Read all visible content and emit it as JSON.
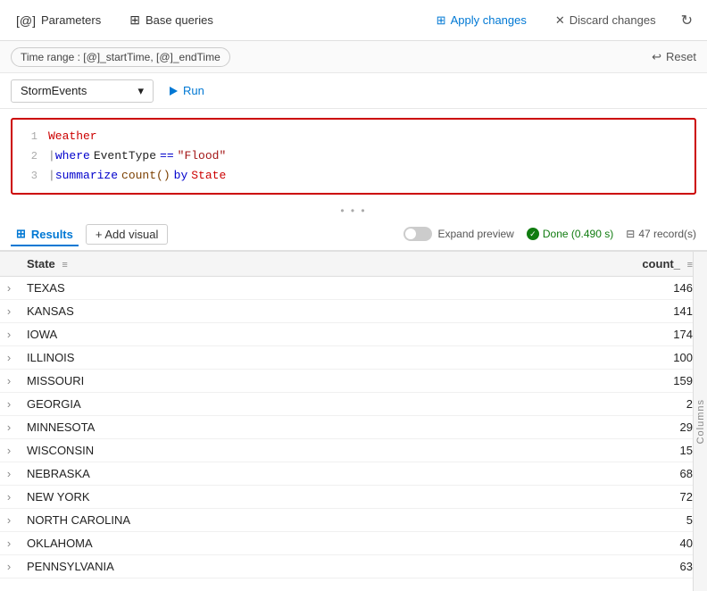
{
  "toolbar": {
    "parameters_label": "Parameters",
    "base_queries_label": "Base queries",
    "apply_label": "Apply changes",
    "discard_label": "Discard changes"
  },
  "time_range": {
    "label": "Time range : [@]_startTime, [@]_endTime",
    "reset_label": "Reset"
  },
  "query_bar": {
    "dataset": "StormEvents",
    "run_label": "Run"
  },
  "code": {
    "line1": "Weather",
    "line2_pipe": "|",
    "line2_kw": "where",
    "line2_field": "EventType",
    "line2_op": "==",
    "line2_val": "\"Flood\"",
    "line3_pipe": "|",
    "line3_kw": "summarize",
    "line3_fn": "count()",
    "line3_by": "by",
    "line3_field": "State"
  },
  "results": {
    "tab_label": "Results",
    "add_visual_label": "+ Add visual",
    "expand_preview_label": "Expand preview",
    "status_label": "Done (0.490 s)",
    "records_label": "47 record(s)"
  },
  "table": {
    "col_state": "State",
    "col_count": "count_",
    "rows": [
      {
        "state": "TEXAS",
        "count": "146"
      },
      {
        "state": "KANSAS",
        "count": "141"
      },
      {
        "state": "IOWA",
        "count": "174"
      },
      {
        "state": "ILLINOIS",
        "count": "100"
      },
      {
        "state": "MISSOURI",
        "count": "159"
      },
      {
        "state": "GEORGIA",
        "count": "2"
      },
      {
        "state": "MINNESOTA",
        "count": "29"
      },
      {
        "state": "WISCONSIN",
        "count": "15"
      },
      {
        "state": "NEBRASKA",
        "count": "68"
      },
      {
        "state": "NEW YORK",
        "count": "72"
      },
      {
        "state": "NORTH CAROLINA",
        "count": "5"
      },
      {
        "state": "OKLAHOMA",
        "count": "40"
      },
      {
        "state": "PENNSYLVANIA",
        "count": "63"
      }
    ]
  },
  "columns_panel": {
    "label": "Columns"
  }
}
